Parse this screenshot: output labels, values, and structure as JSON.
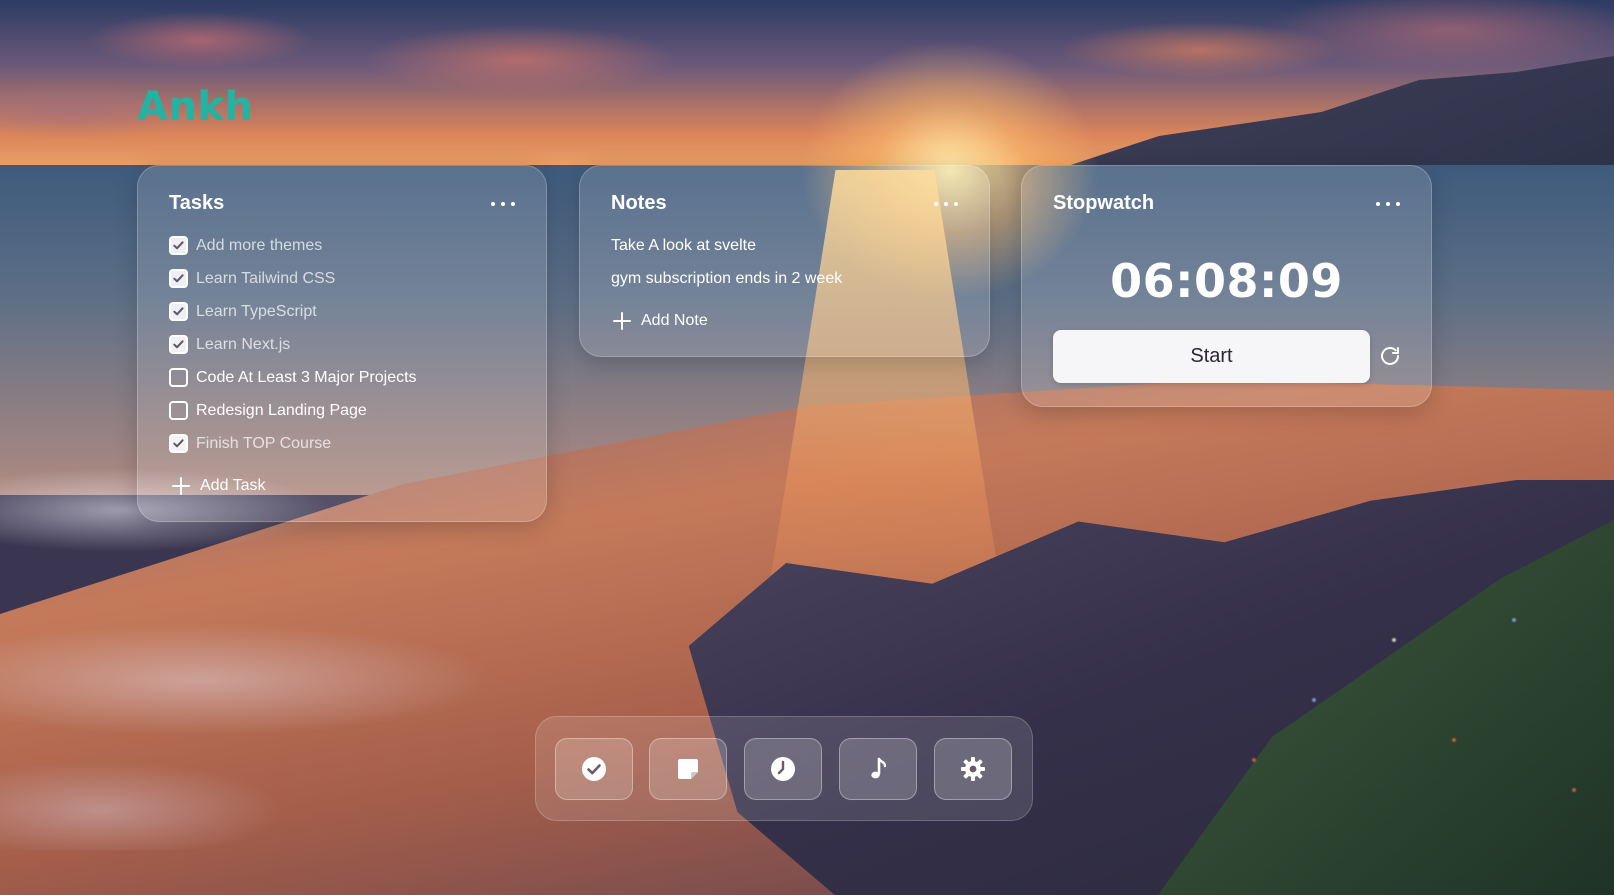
{
  "app": {
    "brand": "Ankh"
  },
  "tasks": {
    "title": "Tasks",
    "more_icon": "more-horizontal-icon",
    "items": [
      {
        "label": "Add more themes",
        "done": true
      },
      {
        "label": "Learn Tailwind CSS",
        "done": true
      },
      {
        "label": "Learn TypeScript",
        "done": true
      },
      {
        "label": "Learn Next.js",
        "done": true
      },
      {
        "label": "Code At Least 3 Major Projects",
        "done": false
      },
      {
        "label": "Redesign Landing Page",
        "done": false
      },
      {
        "label": "Finish TOP Course",
        "done": true
      }
    ],
    "add_label": "Add Task"
  },
  "notes": {
    "title": "Notes",
    "more_icon": "more-horizontal-icon",
    "items": [
      {
        "text": "Take A look at svelte"
      },
      {
        "text": "gym subscription ends in 2 week"
      }
    ],
    "add_label": "Add Note"
  },
  "stopwatch": {
    "title": "Stopwatch",
    "more_icon": "more-horizontal-icon",
    "time": "06:08:09",
    "start_label": "Start",
    "reset_icon": "refresh-icon"
  },
  "dock": {
    "items": [
      {
        "icon": "check-circle-icon",
        "name": "tasks"
      },
      {
        "icon": "sticky-note-icon",
        "name": "notes"
      },
      {
        "icon": "clock-icon",
        "name": "stopwatch"
      },
      {
        "icon": "music-note-icon",
        "name": "music"
      },
      {
        "icon": "gear-icon",
        "name": "settings"
      }
    ]
  },
  "colors": {
    "brand": "#22b3a3",
    "card_text": "#ffffff",
    "button_bg": "#f6f5f7",
    "button_text": "#2a2530"
  }
}
